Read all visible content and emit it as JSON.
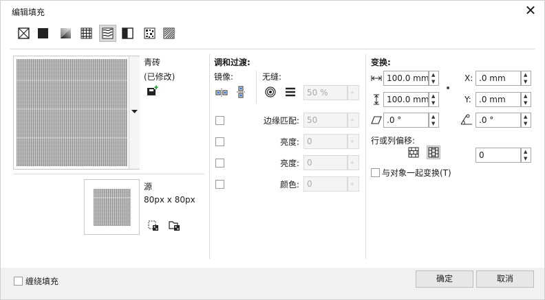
{
  "dialog": {
    "title": "编辑填充",
    "close_glyph": "✕"
  },
  "toolbar": {
    "icons": [
      "no-fill-icon",
      "uniform-fill-icon",
      "fountain-fill-icon",
      "vector-pattern-fill-icon",
      "bitmap-pattern-fill-icon",
      "two-color-pattern-fill-icon",
      "texture-fill-icon",
      "postscript-fill-icon"
    ],
    "selected": "bitmap-pattern-fill-icon"
  },
  "pattern": {
    "name": "青砖",
    "modified": "(已修改)"
  },
  "source": {
    "label": "源",
    "size": "80px x 80px"
  },
  "blend": {
    "heading": "调和过渡:",
    "mirror_label": "镜像:",
    "seamless_label": "无缝:",
    "seamless_value": "50 %",
    "edge_match_label": "边缘匹配:",
    "edge_match_value": "50",
    "brightness_label": "亮度:",
    "brightness_value": "0",
    "luminance_label": "亮度:",
    "luminance_value": "0",
    "color_label": "颜色:",
    "color_value": "0"
  },
  "transform": {
    "heading": "变换:",
    "width": "100.0 mm",
    "height": "100.0 mm",
    "x_label": "X:",
    "x_value": ".0 mm",
    "y_label": "Y:",
    "y_value": ".0 mm",
    "skew": ".0 °",
    "rotate": ".0 °",
    "offset_label": "行或列偏移:",
    "offset_value": "0",
    "transform_with_object": "与对象一起变换(T)"
  },
  "footer": {
    "wrap_fill": "缠绕填充",
    "ok": "确定",
    "cancel": "取消"
  },
  "colors": {
    "accent_green": "#2e9e3e",
    "border": "#d9d9d9"
  }
}
